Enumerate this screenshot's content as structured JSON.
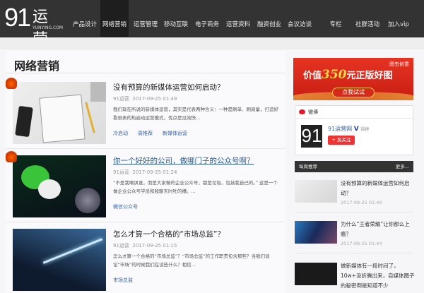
{
  "nav": {
    "logo_num": "91",
    "logo_text": "运营",
    "logo_domain": "YUNYING.COM",
    "items": [
      "产品设计",
      "网络营销",
      "运营管理",
      "移动互联",
      "电子商务",
      "运营资料",
      "融资创业",
      "会议访谈",
      "专栏",
      "社群活动",
      "加入vip"
    ],
    "active": 1
  },
  "main": {
    "heading": "网络营销",
    "articles": [
      {
        "title": "没有预算的新媒体运营如何启动？",
        "author": "91运营",
        "date": "2017-09-25 01:49",
        "desc": "我们现在所说的新媒体运营，其实是代表两种含义：一种是刷单、刷阅量，打造好看很表的热启动运营模式，优点是见效快...",
        "tags": [
          "冷启动",
          "周推荐",
          "新媒体运营"
        ]
      },
      {
        "title": "你一个好好的公司，做哪门子的公众号啊？",
        "author": "91运营",
        "date": "2017-09-25 01:24",
        "desc": "“不是我嘲讽谁，而是大家做的企业公众号，都是垃圾，包括我自己的。” 这是一个做企业公众号学员和我聊天时吐的槽。...",
        "tags": [
          "微信公众号"
        ]
      },
      {
        "title": "怎么才算一个合格的“市场总监”？",
        "author": "91运营",
        "date": "2017-09-25 01:15",
        "desc": "怎么才算一个合格的“市场总监”？“市场总监”的工作职责包含那些？当我们谈论“市场”的时候我们在谈些什么？相信...",
        "tags": [
          "市场总监"
        ]
      }
    ]
  },
  "sidebar": {
    "banner": {
      "brand": "图虫创意",
      "prefix": "价值",
      "amount": "350",
      "suffix": "元正版好图",
      "button": "点我试试"
    },
    "weibo": {
      "label": "微博",
      "name": "91运营网",
      "verified": "V",
      "location": "福建",
      "follow": "+ 加关注"
    },
    "hot": {
      "title": "每周推荐",
      "more": "更多...",
      "items": [
        {
          "title": "没有预算的新媒体运营如何启动？",
          "date": "2017-09-25 01:49"
        },
        {
          "title": "为什么“王者荣耀”让你那么上瘾？",
          "date": "2017-09-25 01:44"
        },
        {
          "title": "做新媒体有一段时间了，10w+没折腾出来，自媒体圈子的秘密倒是知道不少",
          "date": ""
        }
      ]
    }
  },
  "colors": {
    "nav": "#333333",
    "accent": "#e63322",
    "link": "#3366aa"
  }
}
